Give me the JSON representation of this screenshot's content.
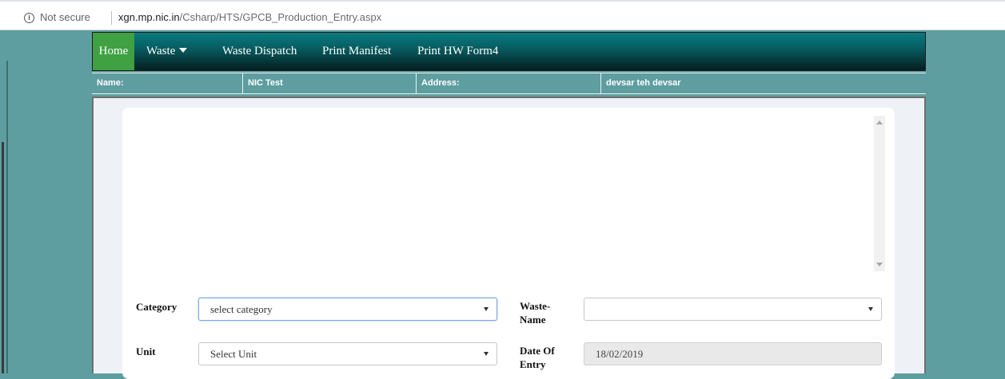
{
  "browser": {
    "security_label": "Not secure",
    "url_host": "xgn.mp.nic.in",
    "url_path": "/Csharp/HTS/GPCB_Production_Entry.aspx"
  },
  "nav": {
    "home": "Home",
    "waste": "Waste",
    "waste_dispatch": "Waste Dispatch",
    "print_manifest": "Print Manifest",
    "print_hw_form4": "Print HW Form4"
  },
  "info": {
    "name_label": "Name:",
    "name_value": "NIC Test",
    "address_label": "Address:",
    "address_value": "devsar teh devsar"
  },
  "form": {
    "category_label": "Category",
    "category_value": "select category",
    "waste_name_label_1": "Waste-",
    "waste_name_label_2": "Name",
    "waste_name_value": "",
    "unit_label": "Unit",
    "unit_value": "Select Unit",
    "date_label_1": "Date Of",
    "date_label_2": "Entry",
    "date_value": "18/02/2019"
  },
  "colors": {
    "background": "#5f9ea0",
    "home_active": "#3fa142",
    "navbar_top": "#0a7a7f",
    "navbar_bottom": "#041e1f"
  }
}
